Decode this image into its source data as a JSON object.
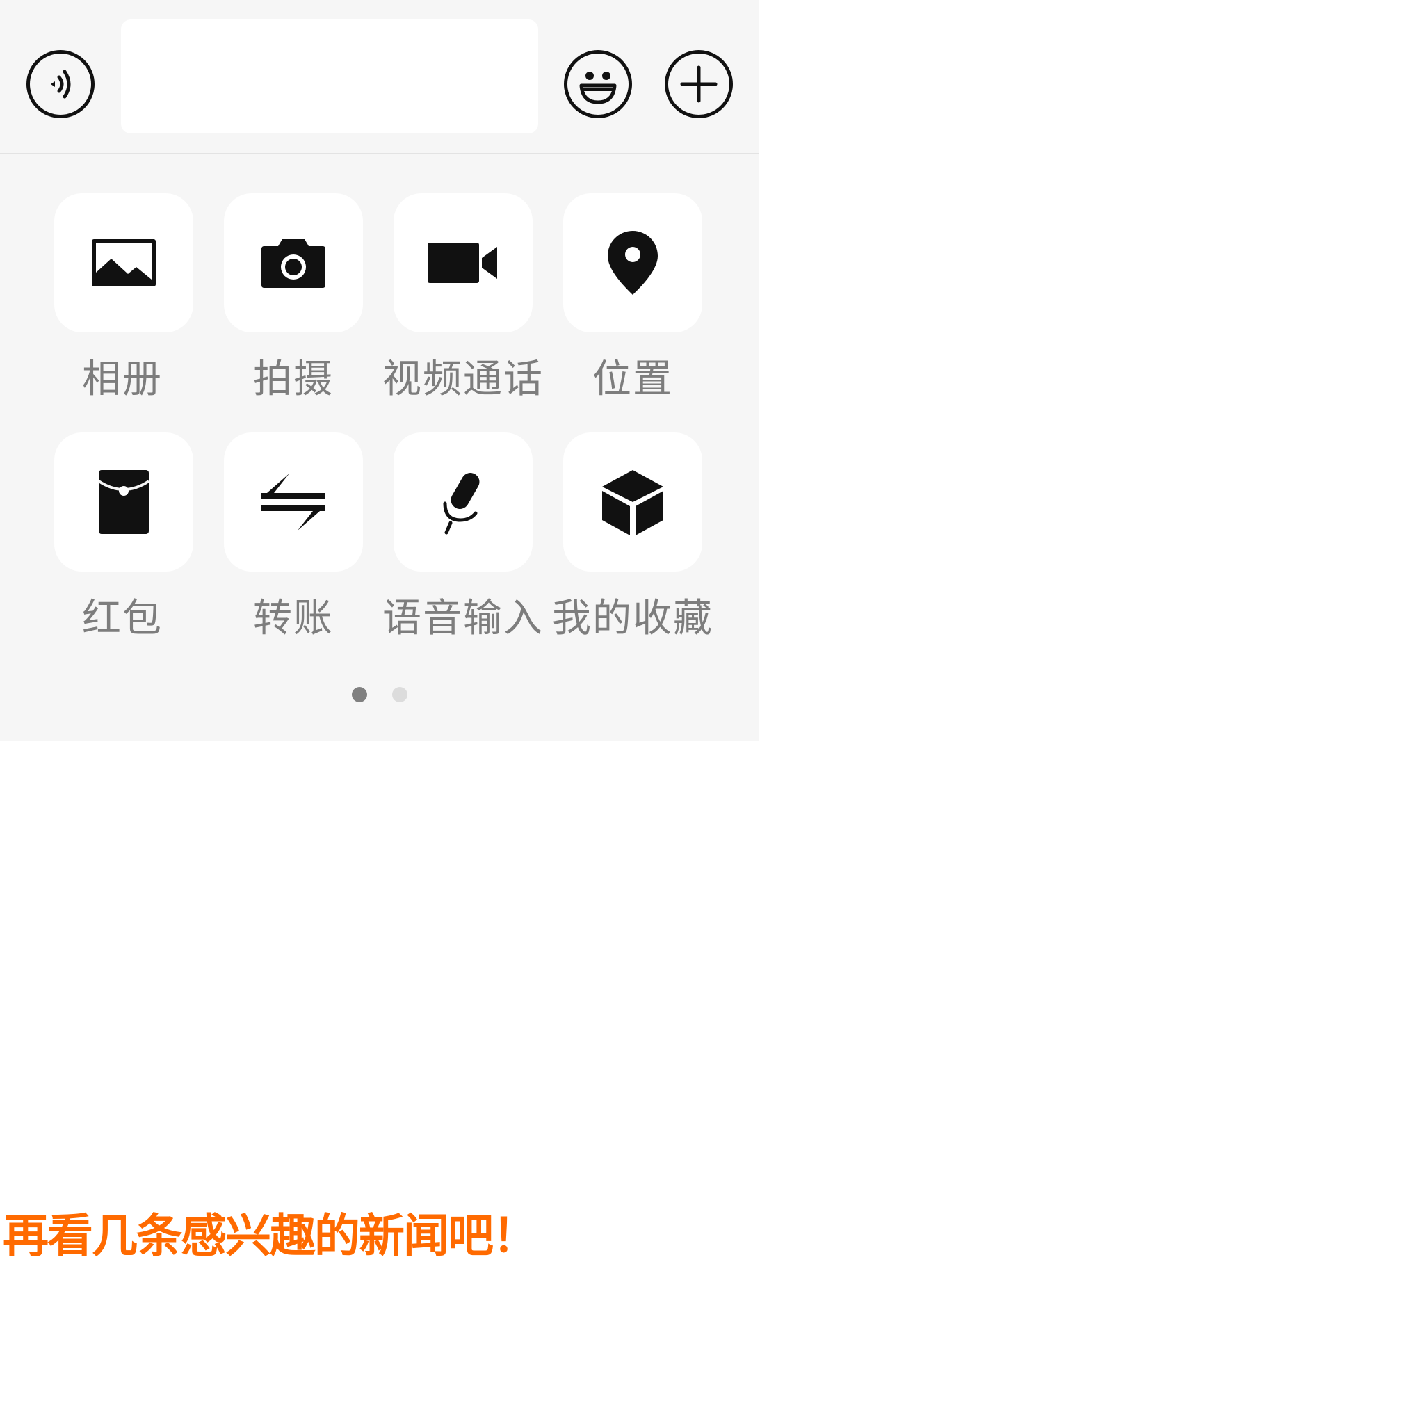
{
  "input_bar": {
    "voice_icon": "voice-wave-icon",
    "message_value": "",
    "emoji_icon": "smiley-icon",
    "more_icon": "plus-icon"
  },
  "more_panel": {
    "items": [
      {
        "label": "相册",
        "icon": "photo-album-icon"
      },
      {
        "label": "拍摄",
        "icon": "camera-icon"
      },
      {
        "label": "视频通话",
        "icon": "video-camera-icon"
      },
      {
        "label": "位置",
        "icon": "location-pin-icon"
      },
      {
        "label": "红包",
        "icon": "red-packet-icon"
      },
      {
        "label": "转账",
        "icon": "transfer-arrows-icon"
      },
      {
        "label": "语音输入",
        "icon": "microphone-icon"
      },
      {
        "label": "我的收藏",
        "icon": "cube-icon"
      }
    ],
    "page_indicator": {
      "current": 1,
      "total": 2
    }
  },
  "news_prompt": "再看几条感兴趣的新闻吧！",
  "colors": {
    "panel_background": "#f6f6f6",
    "label_text": "#7d7d7d",
    "icon": "#111111",
    "news_prompt": "#ff6a00"
  }
}
